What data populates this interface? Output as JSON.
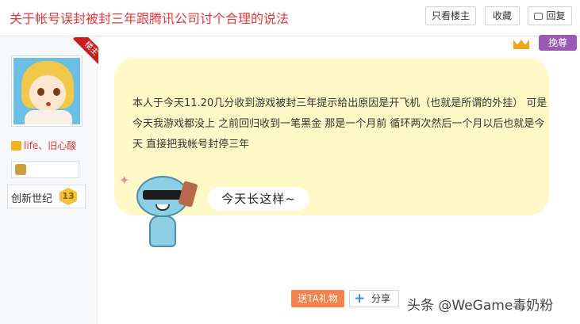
{
  "header": {
    "title": "关于帐号误封被封三年跟腾讯公司讨个合理的说法",
    "only_op_label": "只看楼主",
    "favorite_label": "收藏",
    "reply_label": "回复"
  },
  "author": {
    "op_flag": "楼主",
    "username": "life、旧心酸",
    "level_name": "创新世纪",
    "level_number": "13"
  },
  "badges": {
    "vip_label": "挽尊"
  },
  "post": {
    "text": "本人于今天11.20几分收到游戏被封三年提示给出原因是开飞机（也就是所谓的外挂） 可是今天我游戏都没上 之前回归收到一笔黑金 那是一个月前 循环两次然后一个月以后也就是今天 直接把我帐号封停三年",
    "sticker_caption": "今天长这样~"
  },
  "actions": {
    "gift_label": "送TA礼物",
    "share_label": "分享"
  },
  "watermark": "头条 @WeGame毒奶粉",
  "colors": {
    "title_red": "#e4393c",
    "bubble_yellow": "#fef9c7",
    "gift_orange": "#f5824c",
    "vip_purple": "#9b59b6"
  },
  "icons": {
    "reply": "reply-icon",
    "crown": "crown-icon",
    "share": "plus-icon",
    "user_badge": "user-badge-icon",
    "medal": "medal-icon"
  }
}
